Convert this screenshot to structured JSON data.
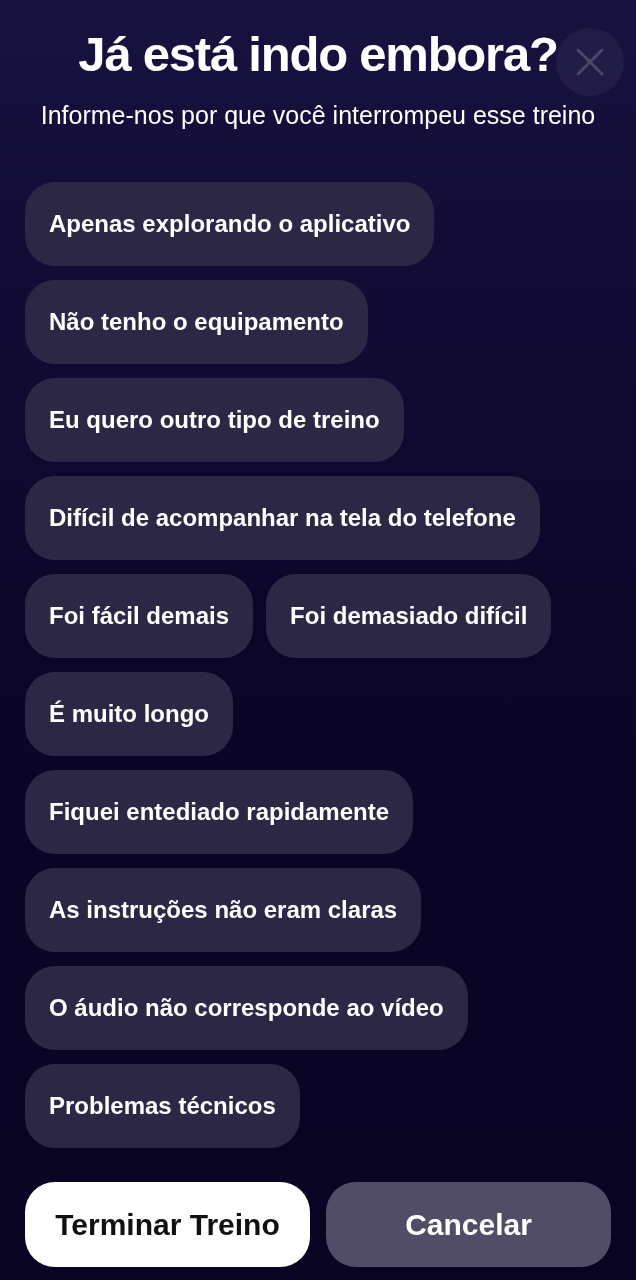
{
  "title": "Já está indo embora?",
  "subtitle": "Informe-nos por que você interrompeu esse treino",
  "reasons": [
    {
      "label": "Apenas explorando o aplicativo",
      "selected": false
    },
    {
      "label": "Não tenho o equipamento",
      "selected": false
    },
    {
      "label": "Eu quero outro tipo de treino",
      "selected": false
    },
    {
      "label": "Difícil de acompanhar na tela do telefone",
      "selected": false
    },
    {
      "label": "Foi fácil demais",
      "selected": false
    },
    {
      "label": "Foi demasiado difícil",
      "selected": false
    },
    {
      "label": "É muito longo",
      "selected": false
    },
    {
      "label": "Fiquei entediado rapidamente",
      "selected": false
    },
    {
      "label": "As instruções não eram claras",
      "selected": false
    },
    {
      "label": "O áudio não corresponde ao vídeo",
      "selected": false
    },
    {
      "label": "Problemas técnicos",
      "selected": false
    }
  ],
  "buttons": [
    {
      "label": "Terminar Treino",
      "kind": "primary"
    },
    {
      "label": "Cancelar",
      "kind": "secondary"
    }
  ]
}
